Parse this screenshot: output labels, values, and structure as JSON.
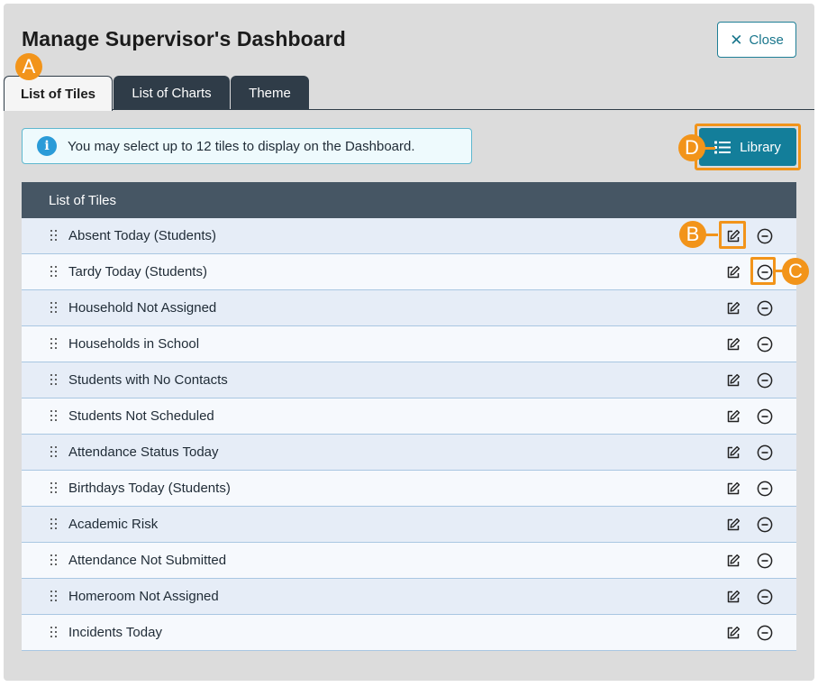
{
  "dialog": {
    "title": "Manage Supervisor's Dashboard",
    "close_label": "Close"
  },
  "tabs": [
    {
      "label": "List of Tiles",
      "active": true
    },
    {
      "label": "List of Charts",
      "active": false
    },
    {
      "label": "Theme",
      "active": false
    }
  ],
  "info_message": "You may select up to 12 tiles to display on the Dashboard.",
  "library_label": "Library",
  "table": {
    "header": "List of Tiles",
    "rows": [
      {
        "label": "Absent Today (Students)"
      },
      {
        "label": "Tardy Today (Students)"
      },
      {
        "label": "Household Not Assigned"
      },
      {
        "label": "Households in School"
      },
      {
        "label": "Students with No Contacts"
      },
      {
        "label": "Students Not Scheduled"
      },
      {
        "label": "Attendance Status Today"
      },
      {
        "label": "Birthdays Today (Students)"
      },
      {
        "label": "Academic Risk"
      },
      {
        "label": "Attendance Not Submitted"
      },
      {
        "label": "Homeroom Not Assigned"
      },
      {
        "label": "Incidents Today"
      }
    ]
  },
  "callouts": {
    "a": "A",
    "b": "B",
    "c": "C",
    "d": "D"
  },
  "colors": {
    "accent": "#137e9a",
    "callout": "#f2941a",
    "header_bg": "#465664",
    "tab_dark": "#2f3c48"
  },
  "icons": {
    "close": "close-icon",
    "info": "info-icon",
    "library": "list-icon",
    "drag": "drag-handle-icon",
    "edit": "edit-icon",
    "remove": "remove-circle-icon"
  }
}
